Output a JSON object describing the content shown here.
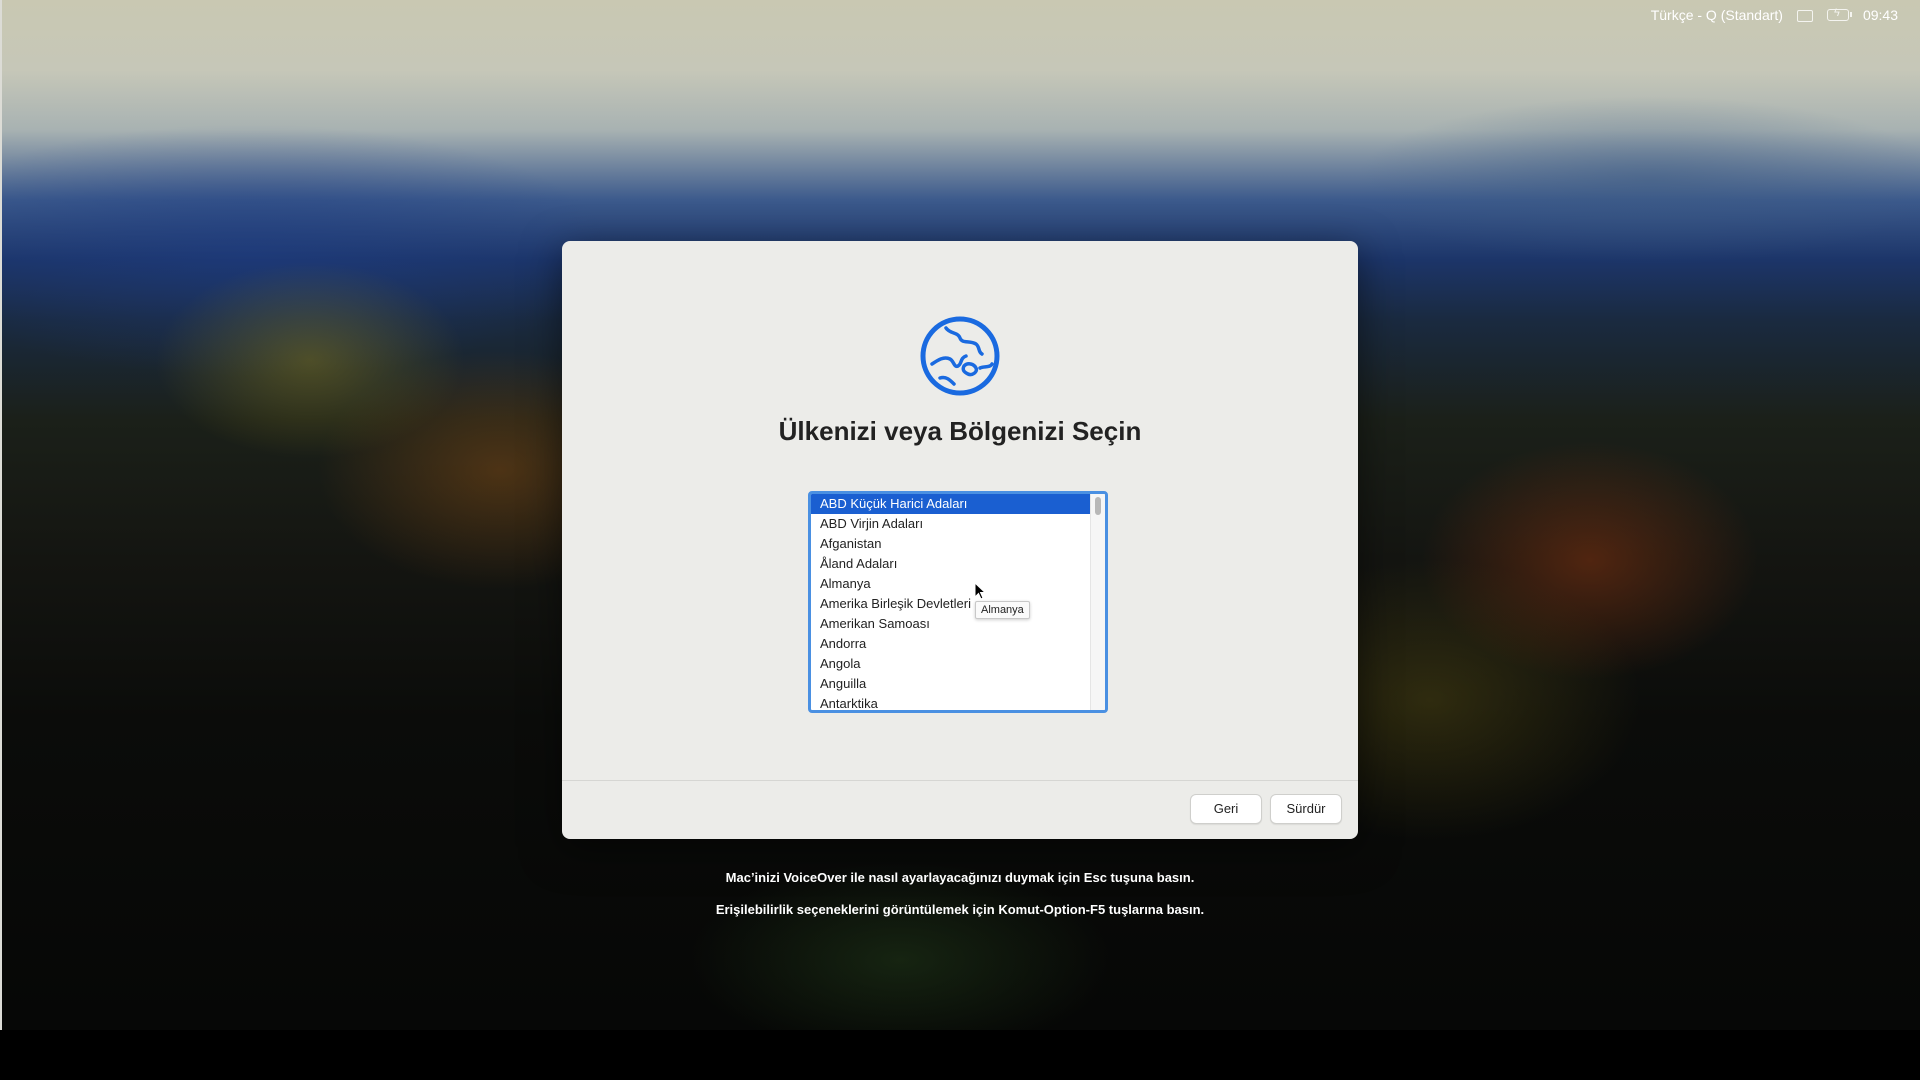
{
  "menubar": {
    "input_source": "Türkçe - Q (Standart)",
    "time": "09:43"
  },
  "dialog": {
    "title": "Ülkenizi veya Bölgenizi Seçin",
    "icon": "globe-icon",
    "accent_color": "#1a6ae0",
    "countries": [
      "ABD Küçük Harici Adaları",
      "ABD Virjin Adaları",
      "Afganistan",
      "Åland Adaları",
      "Almanya",
      "Amerika Birleşik Devletleri",
      "Amerikan Samoası",
      "Andorra",
      "Angola",
      "Anguilla",
      "Antarktika"
    ],
    "selected_country": "ABD Küçük Harici Adaları",
    "tooltip": "Almanya",
    "back_label": "Geri",
    "continue_label": "Sürdür"
  },
  "hints": {
    "voiceover": "Mac’inizi VoiceOver ile nasıl ayarlayacağınızı duymak için Esc tuşuna basın.",
    "accessibility": "Erişilebilirlik seçeneklerini görüntülemek için Komut-Option-F5 tuşlarına basın."
  }
}
